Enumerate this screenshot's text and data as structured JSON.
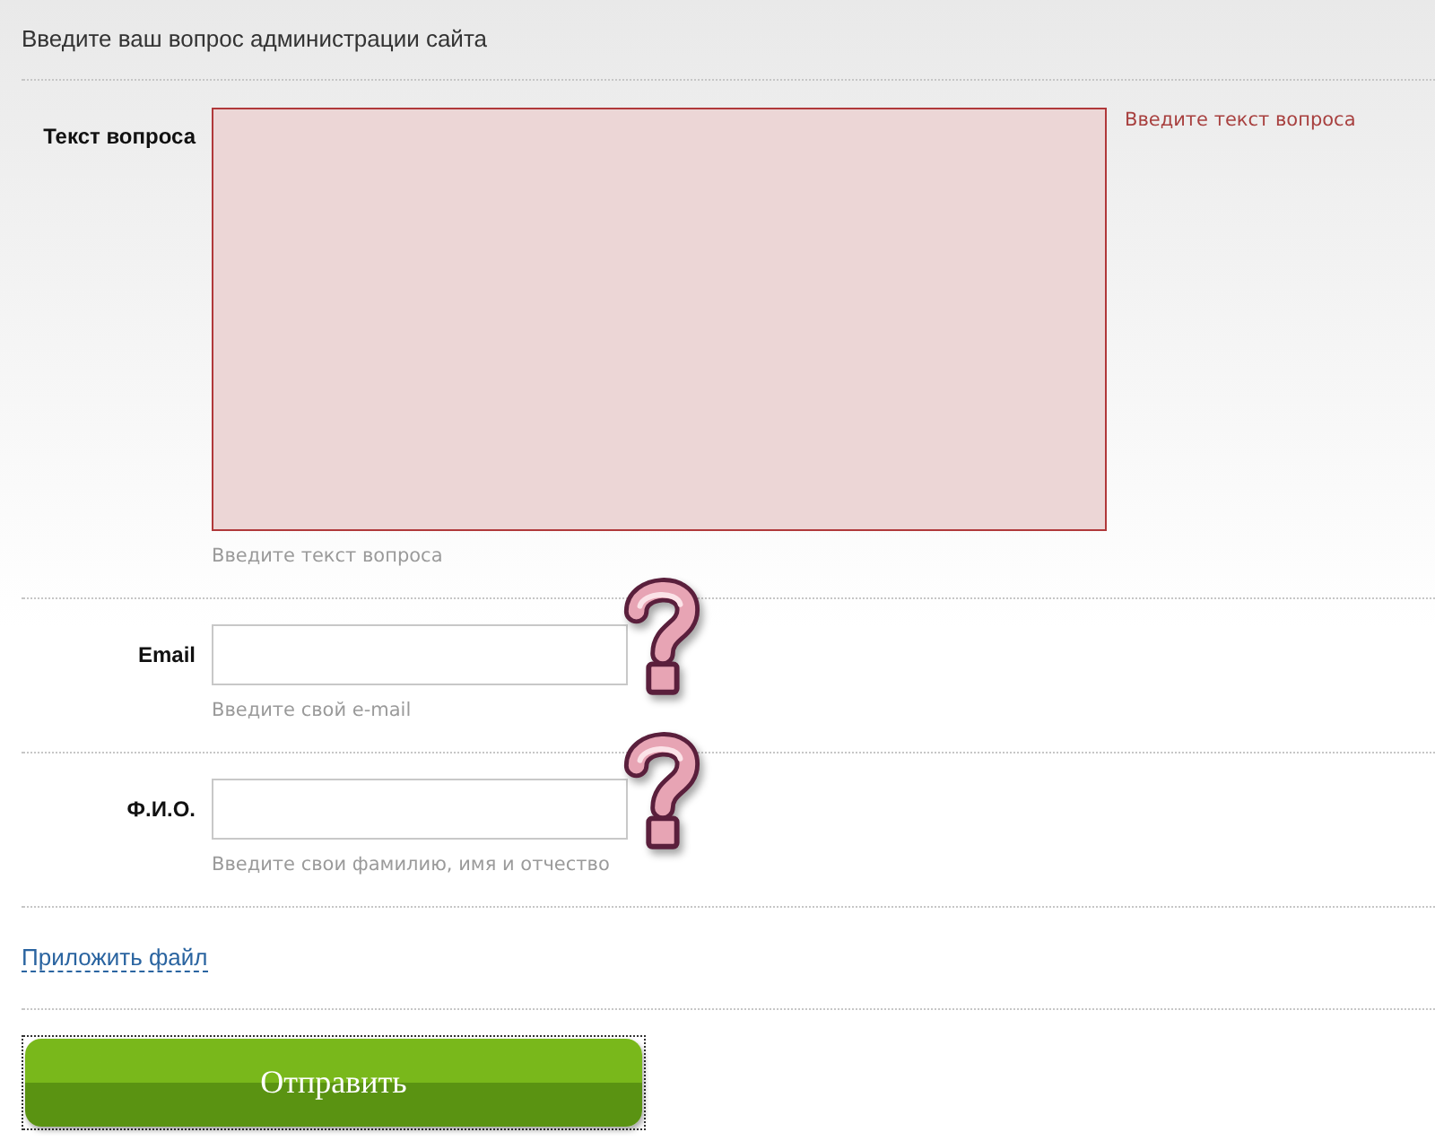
{
  "header": {
    "title": "Введите ваш вопрос администрации сайта"
  },
  "fields": [
    {
      "kind": "textarea",
      "label": "Текст вопроса",
      "hint": "Введите текст вопроса",
      "error": "Введите текст вопроса",
      "invalid": true,
      "help_icon": false
    },
    {
      "kind": "input",
      "label": "Email",
      "hint": "Введите свой e-mail",
      "invalid": false,
      "help_icon": true
    },
    {
      "kind": "input",
      "label": "Ф.И.О.",
      "hint": "Введите свои фамилию, имя и отчество",
      "invalid": false,
      "help_icon": true
    }
  ],
  "attach_link": {
    "label": "Приложить файл"
  },
  "submit_button": {
    "label": "Отправить",
    "focused": true
  }
}
